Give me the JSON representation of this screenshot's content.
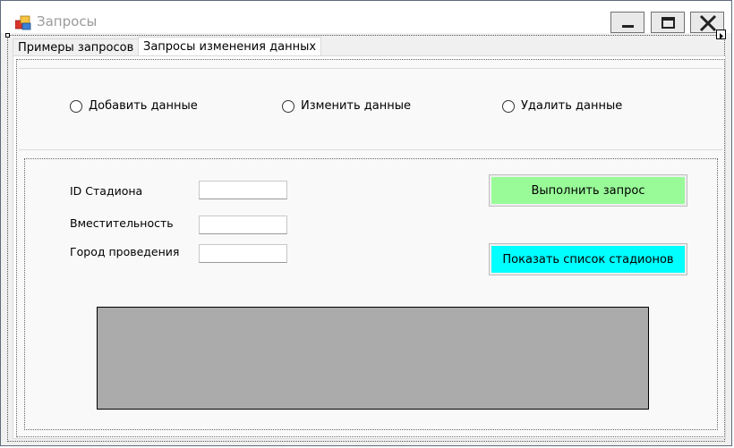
{
  "window": {
    "title": "Запросы",
    "buttons": {
      "minimize": "minimize",
      "maximize": "maximize",
      "close": "close"
    }
  },
  "tabs": [
    {
      "label": "Примеры запросов",
      "active": false
    },
    {
      "label": "Запросы изменения данных",
      "active": true
    }
  ],
  "radios": [
    {
      "label": "Добавить данные",
      "checked": false
    },
    {
      "label": "Изменить данные",
      "checked": false
    },
    {
      "label": "Удалить данные",
      "checked": false
    }
  ],
  "fields": [
    {
      "label": "ID Стадиона",
      "value": ""
    },
    {
      "label": "Вместительность",
      "value": ""
    },
    {
      "label": "Город проведения",
      "value": ""
    }
  ],
  "buttons": {
    "execute": {
      "label": "Выполнить запрос",
      "color": "#98fb98"
    },
    "show_list": {
      "label": "Показать список стадионов",
      "color": "#00ffff"
    }
  },
  "grid": {
    "background": "#ababab"
  }
}
